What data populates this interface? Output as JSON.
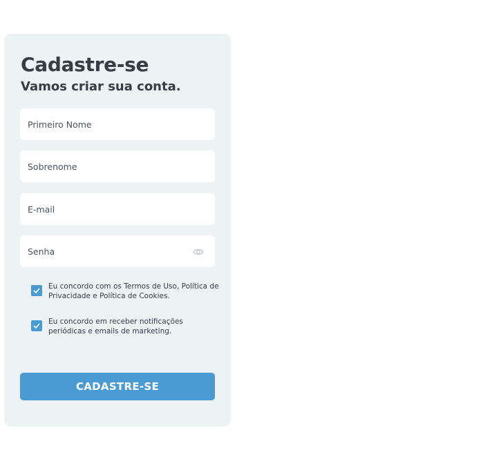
{
  "form": {
    "title": "Cadastre-se",
    "subtitle": "Vamos criar sua conta.",
    "fields": {
      "first_name_placeholder": "Primeiro Nome",
      "last_name_placeholder": "Sobrenome",
      "email_placeholder": "E-mail",
      "password_placeholder": "Senha",
      "password_toggle_icon": "eye-icon"
    },
    "checkboxes": [
      {
        "label": "Eu concordo com os Termos de Uso, Política de Privacidade e Política de Cookies.",
        "checked": true
      },
      {
        "label": "Eu concordo em receber notificações periódicas e emails de marketing.",
        "checked": true
      }
    ],
    "submit_label": "CADASTRE-SE"
  },
  "colors": {
    "card_background": "#edf2f5",
    "accent": "#4a9ad4",
    "text": "#363d47"
  }
}
